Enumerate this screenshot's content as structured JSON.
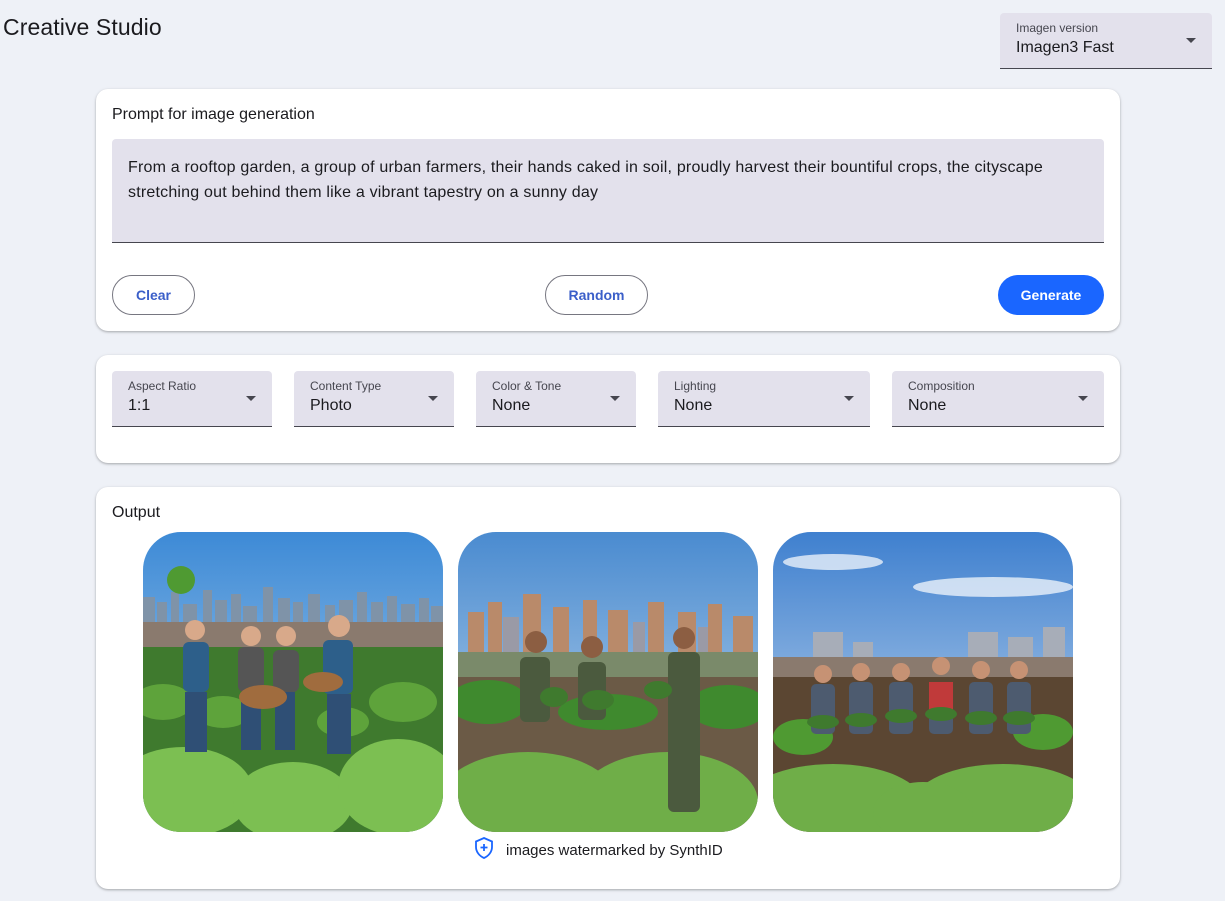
{
  "app": {
    "title": "Creative Studio"
  },
  "model_select": {
    "label": "Imagen version",
    "value": "Imagen3 Fast"
  },
  "prompt": {
    "title": "Prompt for image generation",
    "text": "From a rooftop garden, a group of urban farmers, their hands caked in soil, proudly harvest their bountiful crops, the cityscape stretching out behind them like a vibrant tapestry on a sunny day",
    "clear_label": "Clear",
    "random_label": "Random",
    "generate_label": "Generate"
  },
  "options": [
    {
      "label": "Aspect Ratio",
      "value": "1:1"
    },
    {
      "label": "Content Type",
      "value": "Photo"
    },
    {
      "label": "Color & Tone",
      "value": "None"
    },
    {
      "label": "Lighting",
      "value": "None"
    },
    {
      "label": "Composition",
      "value": "None"
    }
  ],
  "output": {
    "title": "Output",
    "watermark_text": "images watermarked by SynthID",
    "watermark_icon": "shield-plus-icon"
  },
  "colors": {
    "accent": "#1a66ff",
    "surface": "#e3e1ec",
    "background": "#eef1f7"
  }
}
